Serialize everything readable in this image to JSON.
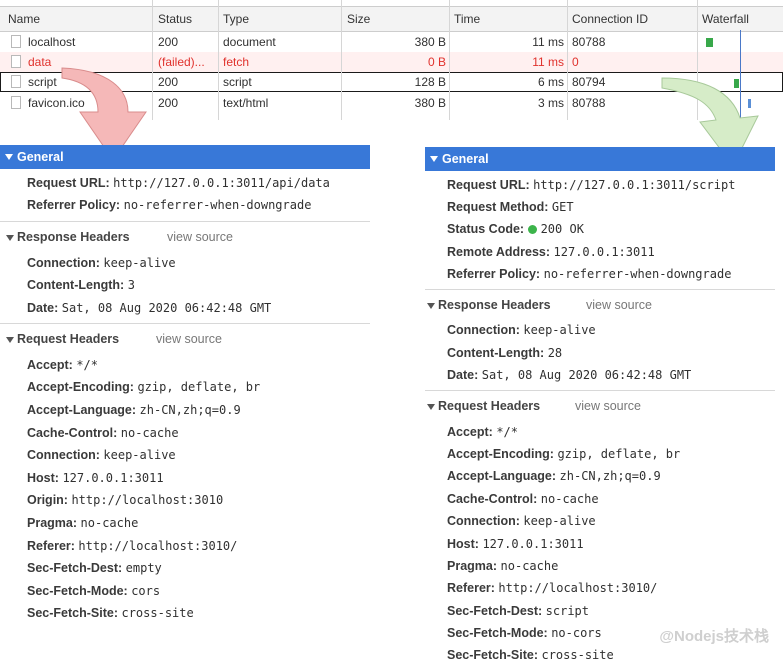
{
  "network": {
    "columns": [
      "Name",
      "Status",
      "Type",
      "Size",
      "Time",
      "Connection ID",
      "Waterfall"
    ],
    "rows": [
      {
        "name": "localhost",
        "status": "200",
        "type": "document",
        "size": "380 B",
        "time": "11 ms",
        "conn": "80788"
      },
      {
        "name": "data",
        "status": "(failed)...",
        "type": "fetch",
        "size": "0 B",
        "time": "11 ms",
        "conn": "0"
      },
      {
        "name": "script",
        "status": "200",
        "type": "script",
        "size": "128 B",
        "time": "6 ms",
        "conn": "80794"
      },
      {
        "name": "favicon.ico",
        "status": "200",
        "type": "text/html",
        "size": "380 B",
        "time": "3 ms",
        "conn": "80788"
      }
    ]
  },
  "left": {
    "general_title": "General",
    "general": [
      {
        "k": "Request URL:",
        "v": "http://127.0.0.1:3011/api/data"
      },
      {
        "k": "Referrer Policy:",
        "v": "no-referrer-when-downgrade"
      }
    ],
    "resp_title": "Response Headers",
    "view_source": "view source",
    "resp": [
      {
        "k": "Connection:",
        "v": "keep-alive"
      },
      {
        "k": "Content-Length:",
        "v": "3"
      },
      {
        "k": "Date:",
        "v": "Sat, 08 Aug 2020 06:42:48 GMT"
      }
    ],
    "req_title": "Request Headers",
    "req": [
      {
        "k": "Accept:",
        "v": "*/*"
      },
      {
        "k": "Accept-Encoding:",
        "v": "gzip, deflate, br"
      },
      {
        "k": "Accept-Language:",
        "v": "zh-CN,zh;q=0.9"
      },
      {
        "k": "Cache-Control:",
        "v": "no-cache"
      },
      {
        "k": "Connection:",
        "v": "keep-alive"
      },
      {
        "k": "Host:",
        "v": "127.0.0.1:3011"
      },
      {
        "k": "Origin:",
        "v": "http://localhost:3010"
      },
      {
        "k": "Pragma:",
        "v": "no-cache"
      },
      {
        "k": "Referer:",
        "v": "http://localhost:3010/"
      },
      {
        "k": "Sec-Fetch-Dest:",
        "v": "empty"
      },
      {
        "k": "Sec-Fetch-Mode:",
        "v": "cors"
      },
      {
        "k": "Sec-Fetch-Site:",
        "v": "cross-site"
      }
    ]
  },
  "right": {
    "general_title": "General",
    "general": [
      {
        "k": "Request URL:",
        "v": "http://127.0.0.1:3011/script"
      },
      {
        "k": "Request Method:",
        "v": "GET"
      },
      {
        "k": "Status Code:",
        "v": "200 OK"
      },
      {
        "k": "Remote Address:",
        "v": "127.0.0.1:3011"
      },
      {
        "k": "Referrer Policy:",
        "v": "no-referrer-when-downgrade"
      }
    ],
    "resp_title": "Response Headers",
    "view_source": "view source",
    "resp": [
      {
        "k": "Connection:",
        "v": "keep-alive"
      },
      {
        "k": "Content-Length:",
        "v": "28"
      },
      {
        "k": "Date:",
        "v": "Sat, 08 Aug 2020 06:42:48 GMT"
      }
    ],
    "req_title": "Request Headers",
    "req": [
      {
        "k": "Accept:",
        "v": "*/*"
      },
      {
        "k": "Accept-Encoding:",
        "v": "gzip, deflate, br"
      },
      {
        "k": "Accept-Language:",
        "v": "zh-CN,zh;q=0.9"
      },
      {
        "k": "Cache-Control:",
        "v": "no-cache"
      },
      {
        "k": "Connection:",
        "v": "keep-alive"
      },
      {
        "k": "Host:",
        "v": "127.0.0.1:3011"
      },
      {
        "k": "Pragma:",
        "v": "no-cache"
      },
      {
        "k": "Referer:",
        "v": "http://localhost:3010/"
      },
      {
        "k": "Sec-Fetch-Dest:",
        "v": "script"
      },
      {
        "k": "Sec-Fetch-Mode:",
        "v": "no-cors"
      },
      {
        "k": "Sec-Fetch-Site:",
        "v": "cross-site"
      }
    ]
  },
  "watermark": "@Nodejs技术栈",
  "colors": {
    "accent": "#3878d8",
    "failed": "#e0322d",
    "status_ok": "#3cb44b",
    "arrow_left": "#f5b8b8",
    "arrow_right": "#cfe6c3"
  }
}
